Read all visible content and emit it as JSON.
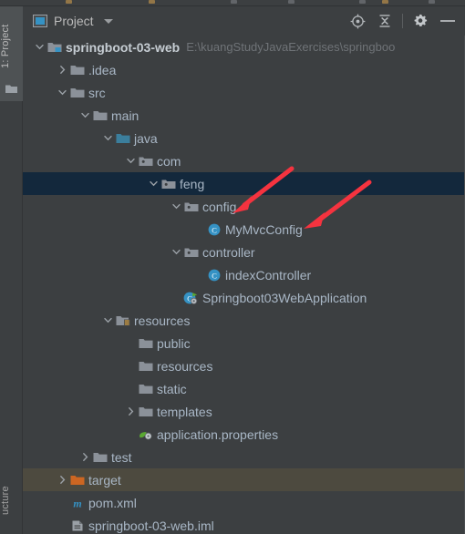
{
  "window": {
    "left_rail": {
      "top_label": "1: Project",
      "bottom_label": "ucture",
      "folder_icon": "folder-icon"
    }
  },
  "header": {
    "icon": "project-panel-icon",
    "title": "Project",
    "dropdown_icon": "chevron-down-icon",
    "buttons": [
      {
        "name": "locate-button",
        "icon": "crosshair-icon"
      },
      {
        "name": "collapse-all-button",
        "icon": "collapse-all-icon"
      },
      {
        "name": "settings-button",
        "icon": "gear-icon"
      },
      {
        "name": "hide-button",
        "icon": "minimize-icon"
      }
    ]
  },
  "tree": {
    "rows": [
      {
        "name": "tree-row-springboot-03-web",
        "depth": 0,
        "toggle": "expanded",
        "icon": "module-folder-icon",
        "label": "springboot-03-web",
        "bold": true,
        "sub": "E:\\kuangStudyJavaExercises\\springboo",
        "state": "normal"
      },
      {
        "name": "tree-row-idea",
        "depth": 1,
        "toggle": "collapsed",
        "icon": "folder-icon",
        "label": ".idea",
        "bold": false,
        "sub": "",
        "state": "normal"
      },
      {
        "name": "tree-row-src",
        "depth": 1,
        "toggle": "expanded",
        "icon": "folder-icon",
        "label": "src",
        "bold": false,
        "sub": "",
        "state": "normal"
      },
      {
        "name": "tree-row-main",
        "depth": 2,
        "toggle": "expanded",
        "icon": "folder-icon",
        "label": "main",
        "bold": false,
        "sub": "",
        "state": "normal"
      },
      {
        "name": "tree-row-java",
        "depth": 3,
        "toggle": "expanded",
        "icon": "source-folder-icon",
        "label": "java",
        "bold": false,
        "sub": "",
        "state": "normal"
      },
      {
        "name": "tree-row-com",
        "depth": 4,
        "toggle": "expanded",
        "icon": "package-icon",
        "label": "com",
        "bold": false,
        "sub": "",
        "state": "normal"
      },
      {
        "name": "tree-row-feng",
        "depth": 5,
        "toggle": "expanded",
        "icon": "package-icon",
        "label": "feng",
        "bold": false,
        "sub": "",
        "state": "selected"
      },
      {
        "name": "tree-row-config",
        "depth": 6,
        "toggle": "expanded",
        "icon": "package-icon",
        "label": "config",
        "bold": false,
        "sub": "",
        "state": "normal"
      },
      {
        "name": "tree-row-mymvcconfig",
        "depth": 7,
        "toggle": "none",
        "icon": "class-icon",
        "label": "MyMvcConfig",
        "bold": false,
        "sub": "",
        "state": "normal"
      },
      {
        "name": "tree-row-controller",
        "depth": 6,
        "toggle": "expanded",
        "icon": "package-icon",
        "label": "controller",
        "bold": false,
        "sub": "",
        "state": "normal"
      },
      {
        "name": "tree-row-indexcontroller",
        "depth": 7,
        "toggle": "none",
        "icon": "class-icon",
        "label": "indexController",
        "bold": false,
        "sub": "",
        "state": "normal"
      },
      {
        "name": "tree-row-springboot03webapplication",
        "depth": 6,
        "toggle": "none",
        "icon": "runnable-class-icon",
        "label": "Springboot03WebApplication",
        "bold": false,
        "sub": "",
        "state": "normal"
      },
      {
        "name": "tree-row-resources",
        "depth": 3,
        "toggle": "expanded",
        "icon": "resource-folder-icon",
        "label": "resources",
        "bold": false,
        "sub": "",
        "state": "normal"
      },
      {
        "name": "tree-row-public",
        "depth": 4,
        "toggle": "none",
        "icon": "folder-icon",
        "label": "public",
        "bold": false,
        "sub": "",
        "state": "normal"
      },
      {
        "name": "tree-row-resources-inner",
        "depth": 4,
        "toggle": "none",
        "icon": "folder-icon",
        "label": "resources",
        "bold": false,
        "sub": "",
        "state": "normal"
      },
      {
        "name": "tree-row-static",
        "depth": 4,
        "toggle": "none",
        "icon": "folder-icon",
        "label": "static",
        "bold": false,
        "sub": "",
        "state": "normal"
      },
      {
        "name": "tree-row-templates",
        "depth": 4,
        "toggle": "collapsed",
        "icon": "folder-icon",
        "label": "templates",
        "bold": false,
        "sub": "",
        "state": "normal"
      },
      {
        "name": "tree-row-application-properties",
        "depth": 4,
        "toggle": "none",
        "icon": "properties-file-icon",
        "label": "application.properties",
        "bold": false,
        "sub": "",
        "state": "normal"
      },
      {
        "name": "tree-row-test",
        "depth": 2,
        "toggle": "collapsed",
        "icon": "folder-icon",
        "label": "test",
        "bold": false,
        "sub": "",
        "state": "normal"
      },
      {
        "name": "tree-row-target",
        "depth": 1,
        "toggle": "collapsed",
        "icon": "excluded-folder-icon",
        "label": "target",
        "bold": false,
        "sub": "",
        "state": "target"
      },
      {
        "name": "tree-row-pom-xml",
        "depth": 1,
        "toggle": "none",
        "icon": "maven-file-icon",
        "label": "pom.xml",
        "bold": false,
        "sub": "",
        "state": "normal"
      },
      {
        "name": "tree-row-iml",
        "depth": 1,
        "toggle": "none",
        "icon": "iml-file-icon",
        "label": "springboot-03-web.iml",
        "bold": false,
        "sub": "",
        "state": "normal"
      }
    ]
  },
  "annotations": {
    "arrow_color": "#f5333f",
    "arrows": [
      {
        "name": "annotation-arrow-config",
        "target": "config"
      },
      {
        "name": "annotation-arrow-mymvcconfig",
        "target": "MyMvcConfig"
      }
    ]
  },
  "colors": {
    "panel_bg": "#3c3f41",
    "selection_bg": "#13283c",
    "excluded_bg": "#4d4a3f",
    "text": "#a9b7c6",
    "muted_text": "#6f7377",
    "accent_blue": "#3592c4",
    "excluded_orange": "#cc6622"
  }
}
